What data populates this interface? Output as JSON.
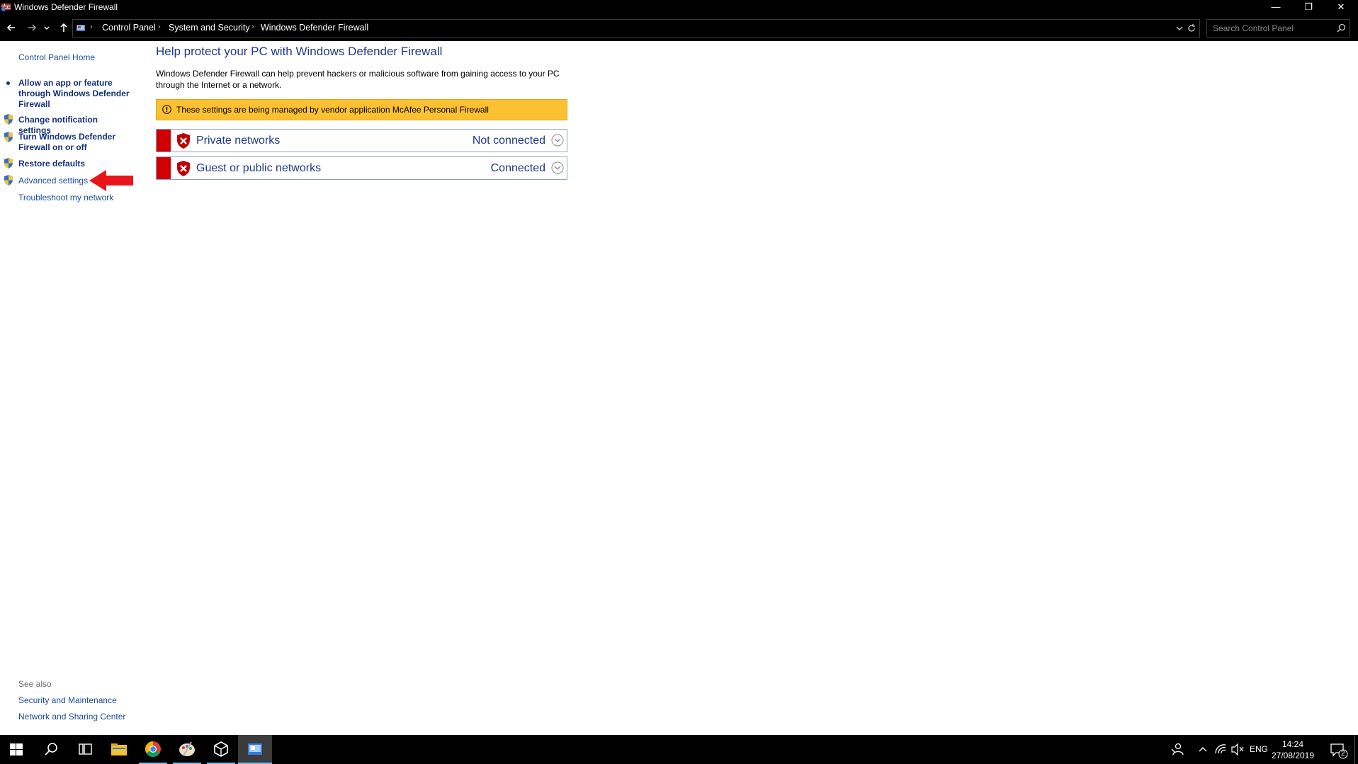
{
  "window": {
    "title": "Windows Defender Firewall",
    "min_glyph": "—",
    "restore_glyph": "❐",
    "close_glyph": "✕"
  },
  "address": {
    "crumbs": [
      "Control Panel",
      "System and Security",
      "Windows Defender Firewall"
    ],
    "search_placeholder": "Search Control Panel"
  },
  "left_pane": {
    "home": "Control Panel Home",
    "tasks": [
      "Allow an app or feature through Windows Defender Firewall",
      "Change notification settings",
      "Turn Windows Defender Firewall on or off",
      "Restore defaults",
      "Advanced settings",
      "Troubleshoot my network"
    ],
    "see_also_heading": "See also",
    "see_also": [
      "Security and Maintenance",
      "Network and Sharing Center"
    ]
  },
  "main": {
    "title": "Help protect your PC with Windows Defender Firewall",
    "description": "Windows Defender Firewall can help prevent hackers or malicious software from gaining access to your PC through the Internet or a network.",
    "banner": "These settings are being managed by vendor application McAfee  Personal Firewall",
    "networks": [
      {
        "label": "Private networks",
        "status": "Not connected"
      },
      {
        "label": "Guest or public networks",
        "status": "Connected"
      }
    ]
  },
  "taskbar": {
    "language": "ENG",
    "time": "14:24",
    "date": "27/08/2019",
    "notifications": "2"
  },
  "colors": {
    "accent_link": "#1e3a8a",
    "banner": "#fcc133",
    "alert_red": "#d00000",
    "annotation": "#e8161b"
  }
}
